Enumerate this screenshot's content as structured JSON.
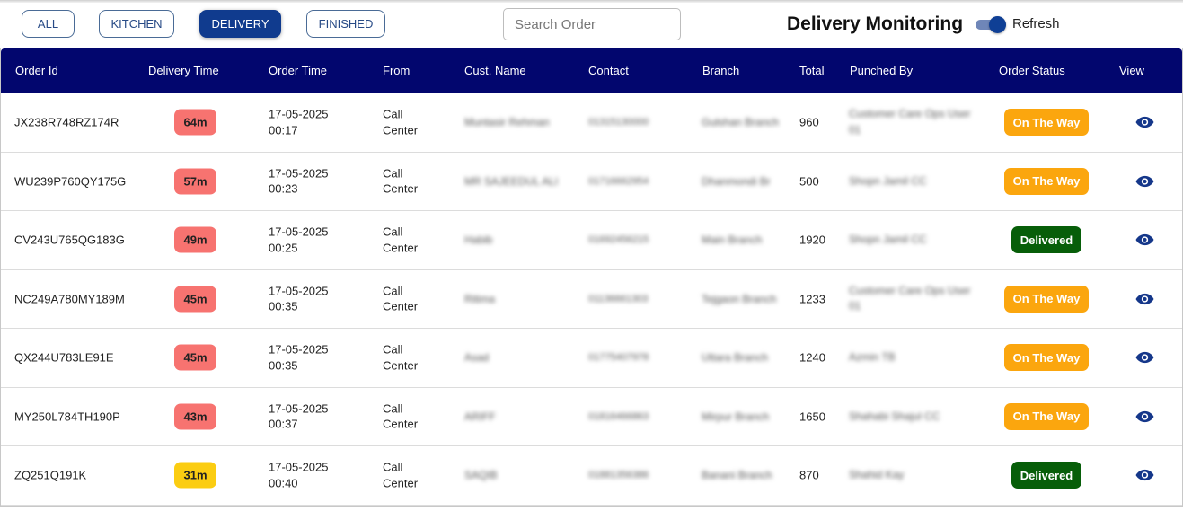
{
  "filters": [
    {
      "label": "ALL",
      "active": false
    },
    {
      "label": "KITCHEN",
      "active": false
    },
    {
      "label": "DELIVERY",
      "active": true
    },
    {
      "label": "FINISHED",
      "active": false
    }
  ],
  "search": {
    "placeholder": "Search Order",
    "value": ""
  },
  "page_title": "Delivery Monitoring",
  "refresh": {
    "label": "Refresh",
    "on": true
  },
  "columns": [
    "Order Id",
    "Delivery Time",
    "Order Time",
    "From",
    "Cust. Name",
    "Contact",
    "Branch",
    "Total",
    "Punched By",
    "Order Status",
    "View"
  ],
  "colors": {
    "header_bg": "#02066e",
    "badge_late": "#f77370",
    "badge_warn": "#fbcd12",
    "status_on_the_way": "#fba60e",
    "status_delivered": "#075e09",
    "active_filter": "#103b8e",
    "eye_icon": "#15378a"
  },
  "rows": [
    {
      "order_id": "JX238R748RZ174R",
      "delivery_time": "64m",
      "delivery_level": "late",
      "order_date": "17-05-2025",
      "order_clock": "00:17",
      "from_l1": "Call",
      "from_l2": "Center",
      "cust_name": "Muntasir Rehman",
      "contact": "01315130000",
      "branch": "Gulshan Branch",
      "total": "960",
      "punched_l1": "Customer Care Ops User",
      "punched_l2": "01",
      "status": "On The Way",
      "status_type": "otw",
      "view_icon": "eye-icon"
    },
    {
      "order_id": "WU239P760QY175G",
      "delivery_time": "57m",
      "delivery_level": "late",
      "order_date": "17-05-2025",
      "order_clock": "00:23",
      "from_l1": "Call",
      "from_l2": "Center",
      "cust_name": "MR SAJEEDUL ALI",
      "contact": "01716662954",
      "branch": "Dhanmondi Br",
      "total": "500",
      "punched_l1": "Shopn Jamil CC",
      "punched_l2": "",
      "status": "On The Way",
      "status_type": "otw",
      "view_icon": "eye-icon"
    },
    {
      "order_id": "CV243U765QG183G",
      "delivery_time": "49m",
      "delivery_level": "late",
      "order_date": "17-05-2025",
      "order_clock": "00:25",
      "from_l1": "Call",
      "from_l2": "Center",
      "cust_name": "Habib",
      "contact": "01692456215",
      "branch": "Main Branch",
      "total": "1920",
      "punched_l1": "Shopn Jamil CC",
      "punched_l2": "",
      "status": "Delivered",
      "status_type": "delivered",
      "view_icon": "eye-icon"
    },
    {
      "order_id": "NC249A780MY189M",
      "delivery_time": "45m",
      "delivery_level": "late",
      "order_date": "17-05-2025",
      "order_clock": "00:35",
      "from_l1": "Call",
      "from_l2": "Center",
      "cust_name": "Ritima",
      "contact": "01136661303",
      "branch": "Tejgaon Branch",
      "total": "1233",
      "punched_l1": "Customer Care Ops User",
      "punched_l2": "01",
      "status": "On The Way",
      "status_type": "otw",
      "view_icon": "eye-icon"
    },
    {
      "order_id": "QX244U783LE91E",
      "delivery_time": "45m",
      "delivery_level": "late",
      "order_date": "17-05-2025",
      "order_clock": "00:35",
      "from_l1": "Call",
      "from_l2": "Center",
      "cust_name": "Asad",
      "contact": "01775407978",
      "branch": "Uttara Branch",
      "total": "1240",
      "punched_l1": "Azmin TB",
      "punched_l2": "",
      "status": "On The Way",
      "status_type": "otw",
      "view_icon": "eye-icon"
    },
    {
      "order_id": "MY250L784TH190P",
      "delivery_time": "43m",
      "delivery_level": "late",
      "order_date": "17-05-2025",
      "order_clock": "00:37",
      "from_l1": "Call",
      "from_l2": "Center",
      "cust_name": "ARIFF",
      "contact": "01816466863",
      "branch": "Mirpur Branch",
      "total": "1650",
      "punched_l1": "Shahabi Shajul CC",
      "punched_l2": "",
      "status": "On The Way",
      "status_type": "otw",
      "view_icon": "eye-icon"
    },
    {
      "order_id": "ZQ251Q191K",
      "delivery_time": "31m",
      "delivery_level": "warn",
      "order_date": "17-05-2025",
      "order_clock": "00:40",
      "from_l1": "Call",
      "from_l2": "Center",
      "cust_name": "SAQIB",
      "contact": "01881356386",
      "branch": "Banani Branch",
      "total": "870",
      "punched_l1": "Shahid Kay",
      "punched_l2": "",
      "status": "Delivered",
      "status_type": "delivered",
      "view_icon": "eye-icon"
    }
  ]
}
